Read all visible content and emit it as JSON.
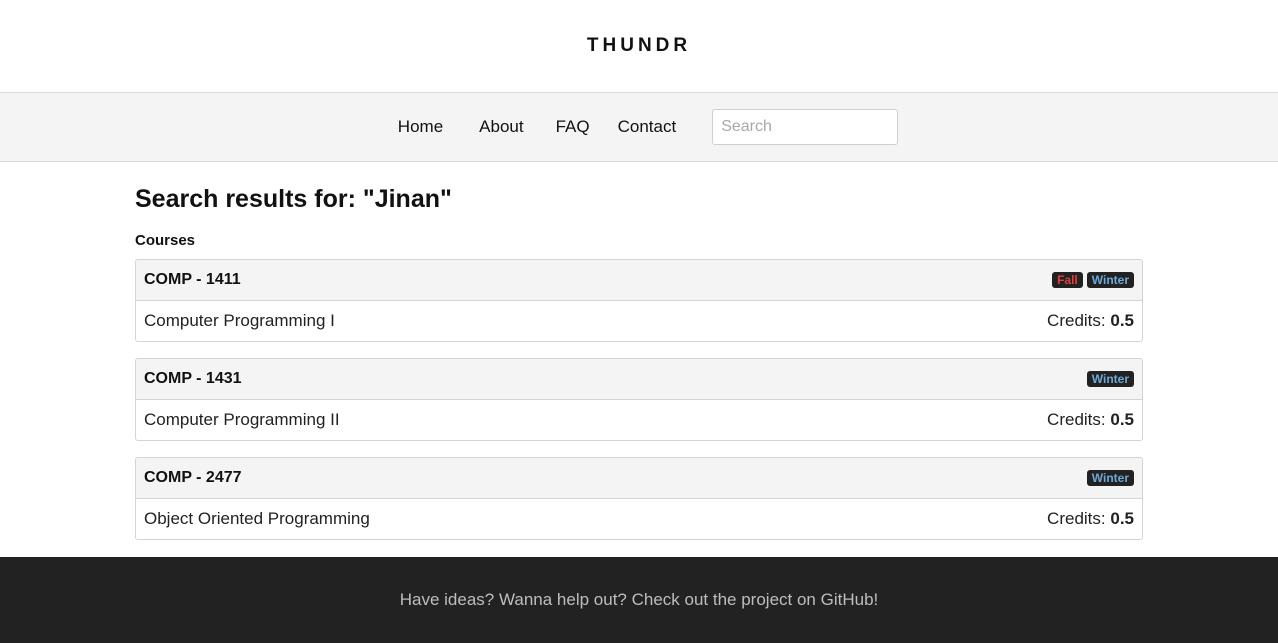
{
  "brand": {
    "name": "THUNDR"
  },
  "nav": {
    "items": [
      {
        "label": "Home"
      },
      {
        "label": "About"
      },
      {
        "label": "FAQ"
      },
      {
        "label": "Contact"
      }
    ],
    "search": {
      "placeholder": "Search",
      "value": ""
    }
  },
  "main": {
    "title": "Search results for: \"Jinan\"",
    "section_heading": "Courses",
    "courses": [
      {
        "code": "COMP - 1411",
        "name": "Computer Programming I",
        "credits_label": "Credits:",
        "credits": "0.5",
        "terms": [
          "Fall",
          "Winter"
        ]
      },
      {
        "code": "COMP - 1431",
        "name": "Computer Programming II",
        "credits_label": "Credits:",
        "credits": "0.5",
        "terms": [
          "Winter"
        ]
      },
      {
        "code": "COMP - 2477",
        "name": "Object Oriented Programming",
        "credits_label": "Credits:",
        "credits": "0.5",
        "terms": [
          "Winter"
        ]
      }
    ]
  },
  "footer": {
    "text": "Have ideas? Wanna help out? Check out the project on GitHub!"
  },
  "colors": {
    "fall_badge": "#e04040",
    "winter_badge": "#6fa8d6",
    "footer_bg": "#222222",
    "navbar_bg": "#f4f4f4"
  }
}
